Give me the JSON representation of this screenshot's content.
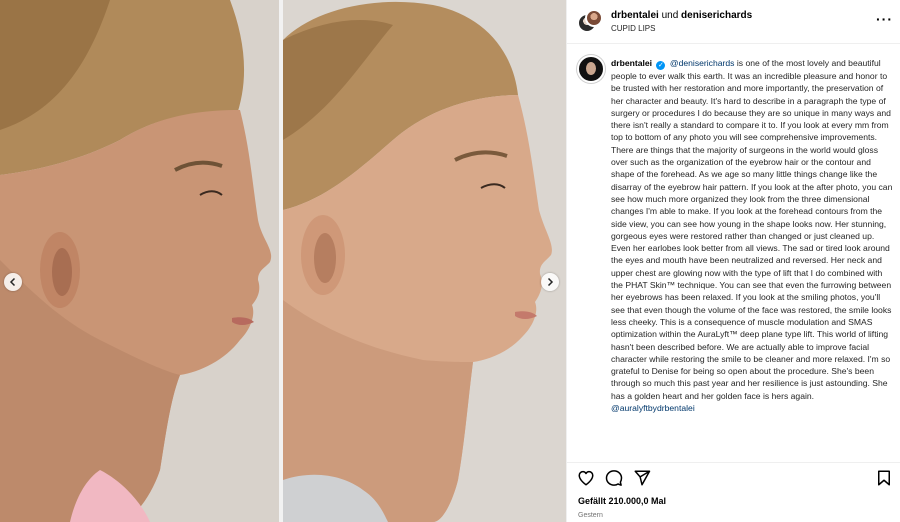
{
  "header": {
    "user1": "drbentalei",
    "joiner": "und",
    "user2": "deniserichards",
    "subtitle": "CUPID LIPS",
    "more_icon": "more-horizontal-icon"
  },
  "caption": {
    "author": "drbentalei",
    "mention_start": "@deniserichards",
    "body": " is one of the most lovely and beautiful people to ever walk this earth. It was an incredible pleasure and honor to be trusted with her restoration and more importantly, the preservation of her character and beauty. It's hard to describe in a paragraph the type of surgery or procedures I do because they are so unique in many ways and there isn't really a standard to compare it to. If you look at every mm from top to bottom of any photo you will see comprehensive improvements. There are things that the majority of surgeons in the world would gloss over such as the organization of the eyebrow hair or the contour and shape of the forehead. As we age so many little things change like the disarray of the eyebrow hair pattern. If you look at the after photo, you can see how much more organized they look from the three dimensional changes I'm able to make. If you look at the forehead contours from the side view, you can see how young in the shape looks now. Her stunning, gorgeous eyes were restored rather than changed or just cleaned up. Even her earlobes look better from all views. The sad or tired look around the eyes and mouth have been neutralized and reversed. Her neck and upper chest are glowing now with the type of lift that I do combined with the PHAT Skin™ technique. You can see that even the furrowing between her eyebrows has been relaxed. If you look at the smiling photos, you'll see that even though the volume of the face was restored, the smile looks less cheeky. This is a consequence of muscle modulation and SMAS optimization within the AuraLyft™ deep plane type lift. This world of lifting hasn't been described before. We are actually able to improve facial character while restoring the smile to be cleaner and more relaxed. I'm so grateful to Denise for being so open about the procedure. She's been through so much this past year and her resilience is just astounding. She has a golden heart and her golden face is hers again. ",
    "mention_end": "@auralyftbydrbentalei",
    "verified_mark": "✓"
  },
  "actions": {
    "like_icon": "heart-icon",
    "comment_icon": "comment-icon",
    "share_icon": "send-icon",
    "save_icon": "bookmark-icon"
  },
  "likes": "Gefällt 210.000,0 Mal",
  "date": "Gestern",
  "media": {
    "prev_icon": "chevron-left-icon",
    "next_icon": "chevron-right-icon"
  }
}
